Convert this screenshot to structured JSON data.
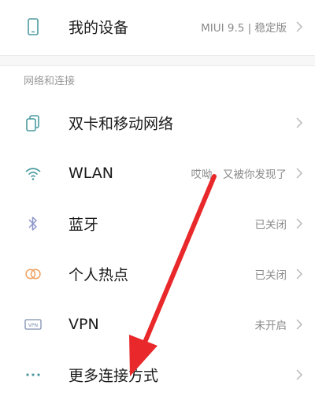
{
  "my_device": {
    "label": "我的设备",
    "value": "MIUI 9.5 | 稳定版",
    "icon": "phone-icon"
  },
  "section": {
    "header": "网络和连接"
  },
  "items": [
    {
      "label": "双卡和移动网络",
      "value": "",
      "icon": "dual-sim-icon"
    },
    {
      "label": "WLAN",
      "value": "哎呦，又被你发现了",
      "icon": "wifi-icon"
    },
    {
      "label": "蓝牙",
      "value": "已关闭",
      "icon": "bluetooth-icon"
    },
    {
      "label": "个人热点",
      "value": "已关闭",
      "icon": "hotspot-icon"
    },
    {
      "label": "VPN",
      "value": "未开启",
      "icon": "vpn-icon"
    },
    {
      "label": "更多连接方式",
      "value": "",
      "icon": "more-dots-icon"
    }
  ],
  "colors": {
    "icon_teal": "#4c9ba0",
    "icon_hotspot": "#f0a060",
    "icon_bluetooth": "#8c95c8",
    "arrow_red": "#e8282a"
  }
}
